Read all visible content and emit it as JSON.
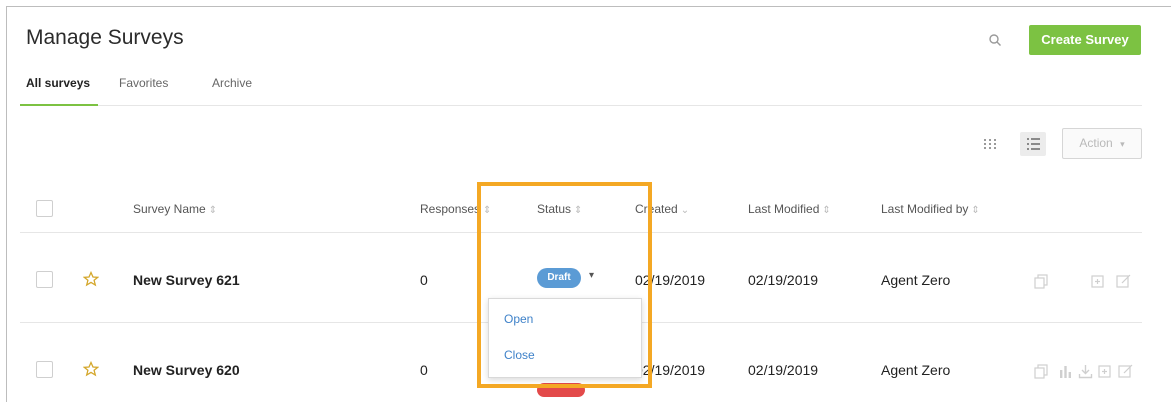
{
  "header": {
    "title": "Manage Surveys",
    "create_label": "Create Survey"
  },
  "tabs": [
    {
      "label": "All surveys"
    },
    {
      "label": "Favorites"
    },
    {
      "label": "Archive"
    }
  ],
  "toolbar": {
    "action_label": "Action"
  },
  "columns": {
    "name": "Survey Name",
    "responses": "Responses",
    "status": "Status",
    "created": "Created",
    "modified": "Last Modified",
    "modified_by": "Last Modified by"
  },
  "rows": [
    {
      "name": "New Survey 621",
      "responses": "0",
      "status": "Draft",
      "created": "02/19/2019",
      "modified": "02/19/2019",
      "modified_by": "Agent Zero"
    },
    {
      "name": "New Survey 620",
      "responses": "0",
      "created": "02/19/2019",
      "modified": "02/19/2019",
      "modified_by": "Agent Zero"
    }
  ],
  "status_menu": {
    "open_label": "Open",
    "close_label": "Close"
  },
  "colors": {
    "accent": "#7cc242",
    "draft": "#5b9bd5",
    "highlight": "#f4a824",
    "link": "#3f82c9"
  }
}
